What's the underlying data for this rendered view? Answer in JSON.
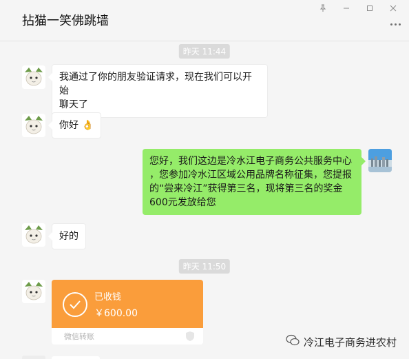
{
  "window": {
    "title": "拈猫一笑佛跳墙",
    "controls": [
      "pin-icon",
      "minimize-icon",
      "maximize-icon",
      "close-icon"
    ]
  },
  "messages": {
    "time1": "昨天 11:44",
    "msg1": "我通过了你的朋友验证请求，现在我们可以开始聊天了",
    "msg1_line1": "我通过了你的朋友验证请求，现在我们可以开始",
    "msg1_line2": "聊天了",
    "msg2": "你好",
    "msg2_emoji": "👌",
    "msg3_line1": "您好，我们这边是冷水江电子商务公共服务中心",
    "msg3_line2": "，您参加冷水江区域公用品牌名称征集，您提报",
    "msg3_line3": "的“尝来冷江”获得第三名，现将第三名的奖金",
    "msg3_line4": "600元发放给您",
    "msg4": "好的",
    "time2": "昨天 11:50"
  },
  "transfer": {
    "status": "已收钱",
    "amount": "￥600.00",
    "footer": "微信转账"
  },
  "watermark": {
    "text": "冷江电子商务进农村"
  },
  "colors": {
    "bubble_right": "#95ec69",
    "transfer_orange": "#fa9d3b",
    "background": "#f5f5f5"
  }
}
